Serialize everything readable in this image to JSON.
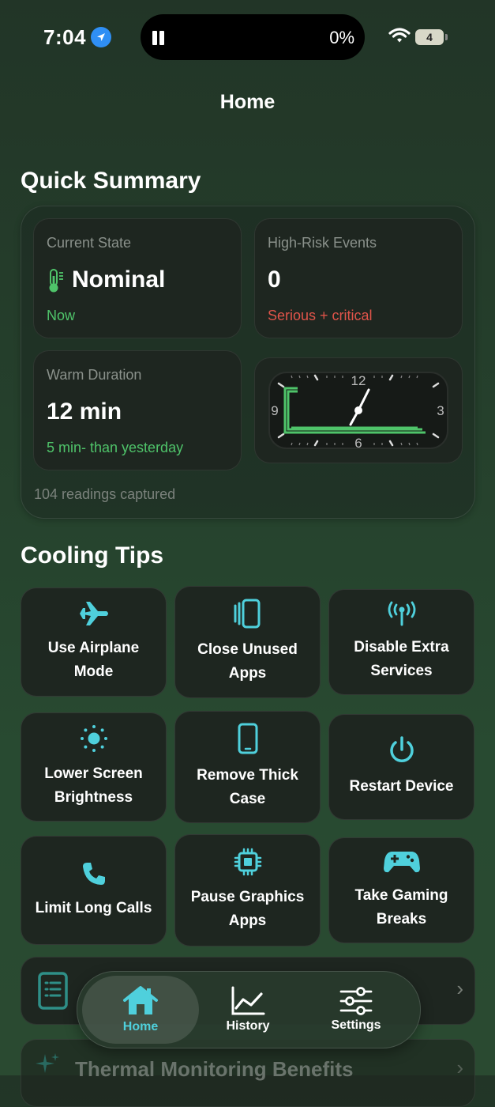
{
  "status": {
    "time": "7:04",
    "island_percent": "0%",
    "battery": "4"
  },
  "nav": {
    "title": "Home"
  },
  "summary": {
    "title": "Quick Summary",
    "current_state": {
      "label": "Current State",
      "value": "Nominal",
      "sub": "Now"
    },
    "high_risk": {
      "label": "High-Risk Events",
      "value": "0",
      "sub": "Serious + critical"
    },
    "warm_duration": {
      "label": "Warm Duration",
      "value": "12 min",
      "sub": "5 min- than yesterday"
    },
    "clock": {
      "n12": "12",
      "n3": "3",
      "n6": "6",
      "n9": "9"
    },
    "readings": "104 readings captured"
  },
  "tips": {
    "title": "Cooling Tips",
    "items": [
      {
        "label": "Use Airplane Mode",
        "icon": "airplane-icon"
      },
      {
        "label": "Close Unused Apps",
        "icon": "app-stack-icon"
      },
      {
        "label": "Disable Extra Services",
        "icon": "antenna-icon"
      },
      {
        "label": "Lower Screen Brightness",
        "icon": "sun-icon"
      },
      {
        "label": "Remove Thick Case",
        "icon": "phone-icon"
      },
      {
        "label": "Restart Device",
        "icon": "power-icon"
      },
      {
        "label": "Limit Long Calls",
        "icon": "phone-call-icon"
      },
      {
        "label": "Pause Graphics Apps",
        "icon": "chip-icon"
      },
      {
        "label": "Take Gaming Breaks",
        "icon": "gamepad-icon"
      }
    ]
  },
  "rows": {
    "benefits_title": "Thermal Monitoring Benefits"
  },
  "tabs": [
    {
      "label": "Home",
      "icon": "house-icon"
    },
    {
      "label": "History",
      "icon": "chart-icon"
    },
    {
      "label": "Settings",
      "icon": "sliders-icon"
    }
  ],
  "colors": {
    "accent": "#4fd0dc",
    "green": "#4fc46a",
    "red": "#e0544a"
  }
}
